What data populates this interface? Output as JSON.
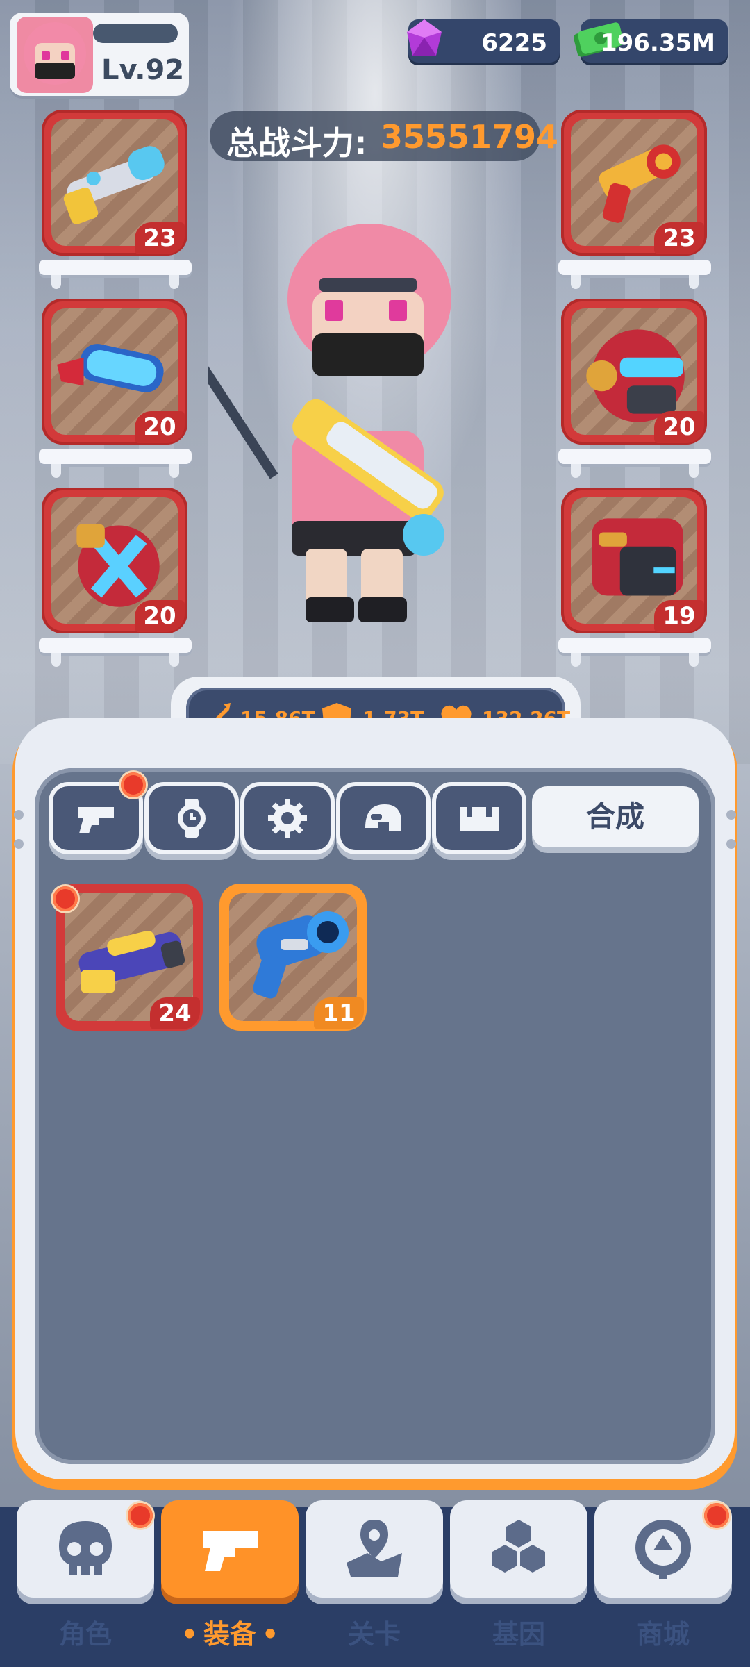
{
  "player": {
    "level": "Lv.92"
  },
  "currencies": {
    "gems": "6225",
    "cash": "196.35M"
  },
  "power": {
    "label": "总战斗力:",
    "value": "35551794"
  },
  "equipment_left": [
    {
      "icon": "sniper-rifle-icon",
      "level": "23"
    },
    {
      "icon": "goggles-icon",
      "level": "20"
    },
    {
      "icon": "shoulder-armor-icon",
      "level": "20"
    }
  ],
  "equipment_right": [
    {
      "icon": "golden-pistol-icon",
      "level": "23"
    },
    {
      "icon": "robot-helmet-icon",
      "level": "20"
    },
    {
      "icon": "chest-armor-icon",
      "level": "19"
    }
  ],
  "stats": {
    "attack": "15.86T",
    "defense": "1.73T",
    "hp": "132.26T"
  },
  "tabs": [
    {
      "icon": "gun-icon"
    },
    {
      "icon": "watch-icon"
    },
    {
      "icon": "gear-icon"
    },
    {
      "icon": "helmet-icon"
    },
    {
      "icon": "armor-icon"
    }
  ],
  "merge_label": "合成",
  "inventory": [
    {
      "icon": "blaster-icon",
      "level": "24",
      "rarity_color": "#d23a3a"
    },
    {
      "icon": "blue-pistol-icon",
      "level": "11",
      "rarity_color": "#ff9a2e"
    }
  ],
  "nav": [
    {
      "label": "角色",
      "icon": "skull-icon"
    },
    {
      "label": "装备",
      "icon": "weapon-icon"
    },
    {
      "label": "关卡",
      "icon": "map-pin-icon"
    },
    {
      "label": "基因",
      "icon": "hexagons-icon"
    },
    {
      "label": "商城",
      "icon": "shop-icon"
    }
  ],
  "colors": {
    "accent": "#ff9a2e",
    "red_rarity": "#d23a3a",
    "orange_rarity": "#ff9a2e",
    "nav_bg": "#2b3e66"
  }
}
